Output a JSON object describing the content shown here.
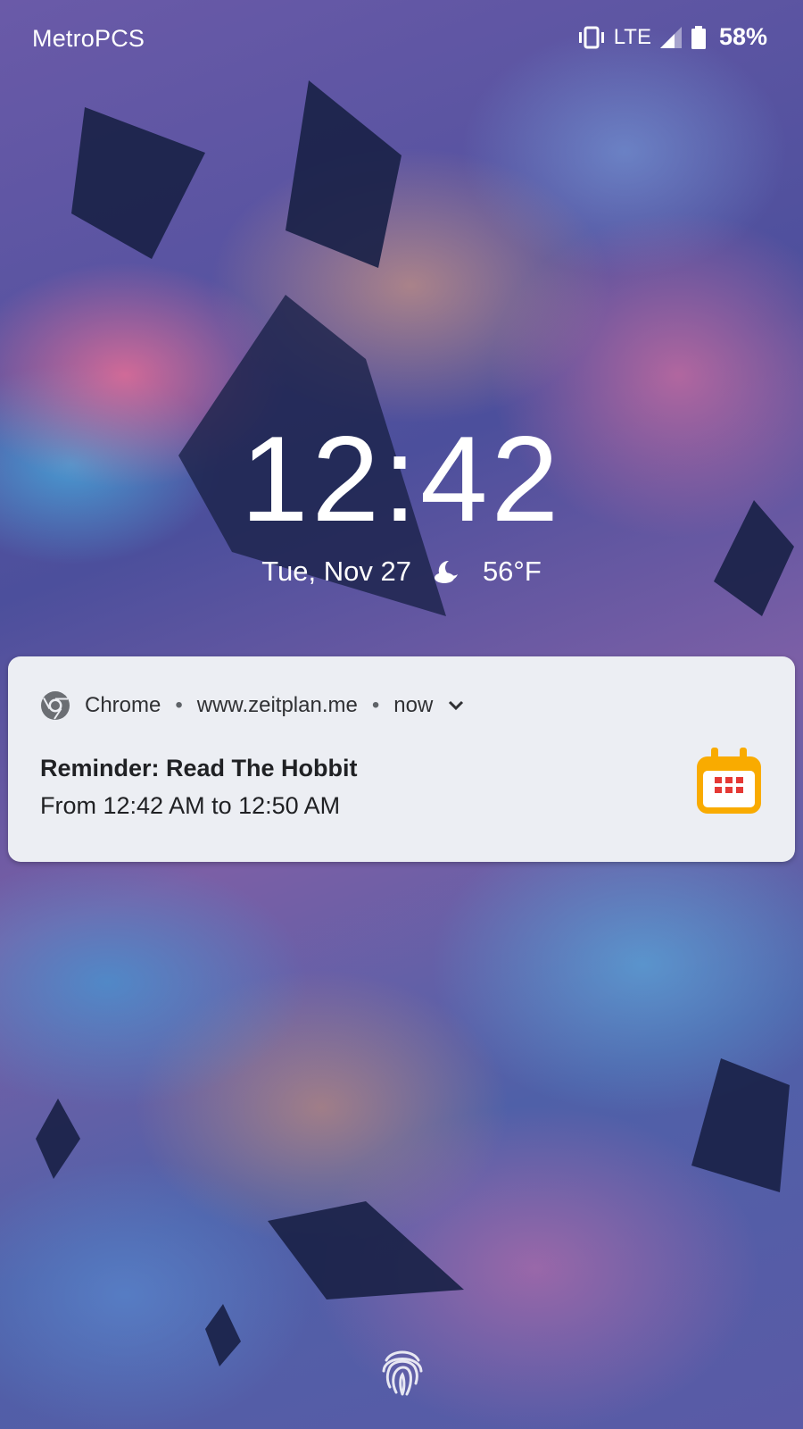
{
  "status_bar": {
    "carrier": "MetroPCS",
    "network": "LTE",
    "battery": "58%"
  },
  "lockscreen": {
    "time": "12:42",
    "date": "Tue, Nov 27",
    "temperature": "56°F",
    "weather_icon": "moon-cloud-icon"
  },
  "notification": {
    "app": "Chrome",
    "source": "www.zeitplan.me",
    "time": "now",
    "title": "Reminder: Read The Hobbit",
    "text": "From 12:42 AM to 12:50 AM",
    "icon": "calendar-icon"
  },
  "colors": {
    "notification_bg": "#eceef3",
    "calendar_accent": "#f9ab00",
    "calendar_dots": "#e53935"
  }
}
